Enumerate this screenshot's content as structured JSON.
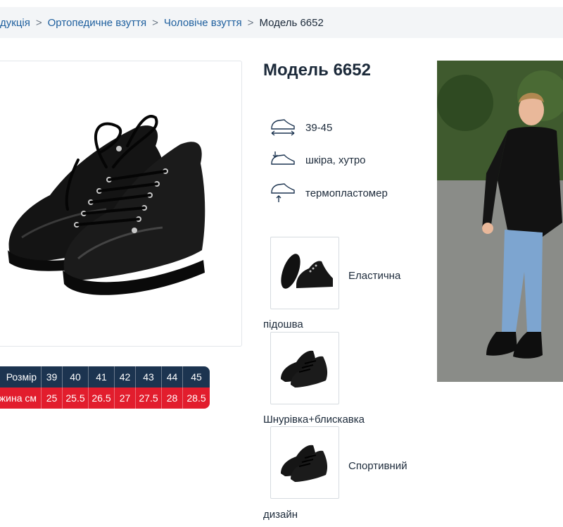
{
  "breadcrumb": {
    "items": [
      "дукція",
      "Ортопедичне взуття",
      "Чоловіче взуття"
    ],
    "separator": ">",
    "current": "Модель 6652"
  },
  "product": {
    "title": "Модель 6652",
    "features": [
      {
        "icon": "shoe-size-icon",
        "text": "39-45"
      },
      {
        "icon": "shoe-material-icon",
        "text": "шкіра, хутро"
      },
      {
        "icon": "shoe-sole-icon",
        "text": "термопластомер"
      }
    ],
    "gallery": [
      {
        "caption_inline": "Еластична",
        "caption_wrap": "підошва"
      },
      {
        "caption_wrap": "Шнурівка+блискавка"
      },
      {
        "caption_inline": "Спортивний",
        "caption_wrap": "дизайн"
      }
    ]
  },
  "size_table": {
    "size_label": "Розмір",
    "length_label": "жина см",
    "sizes": [
      "39",
      "40",
      "41",
      "42",
      "43",
      "44",
      "45"
    ],
    "lengths": [
      "25",
      "25.5",
      "26.5",
      "27",
      "27.5",
      "28",
      "28.5"
    ]
  },
  "colors": {
    "link": "#1e5f9e",
    "table_dark": "#1c3450",
    "table_red": "#e21d2d",
    "text": "#1c2a3a"
  }
}
